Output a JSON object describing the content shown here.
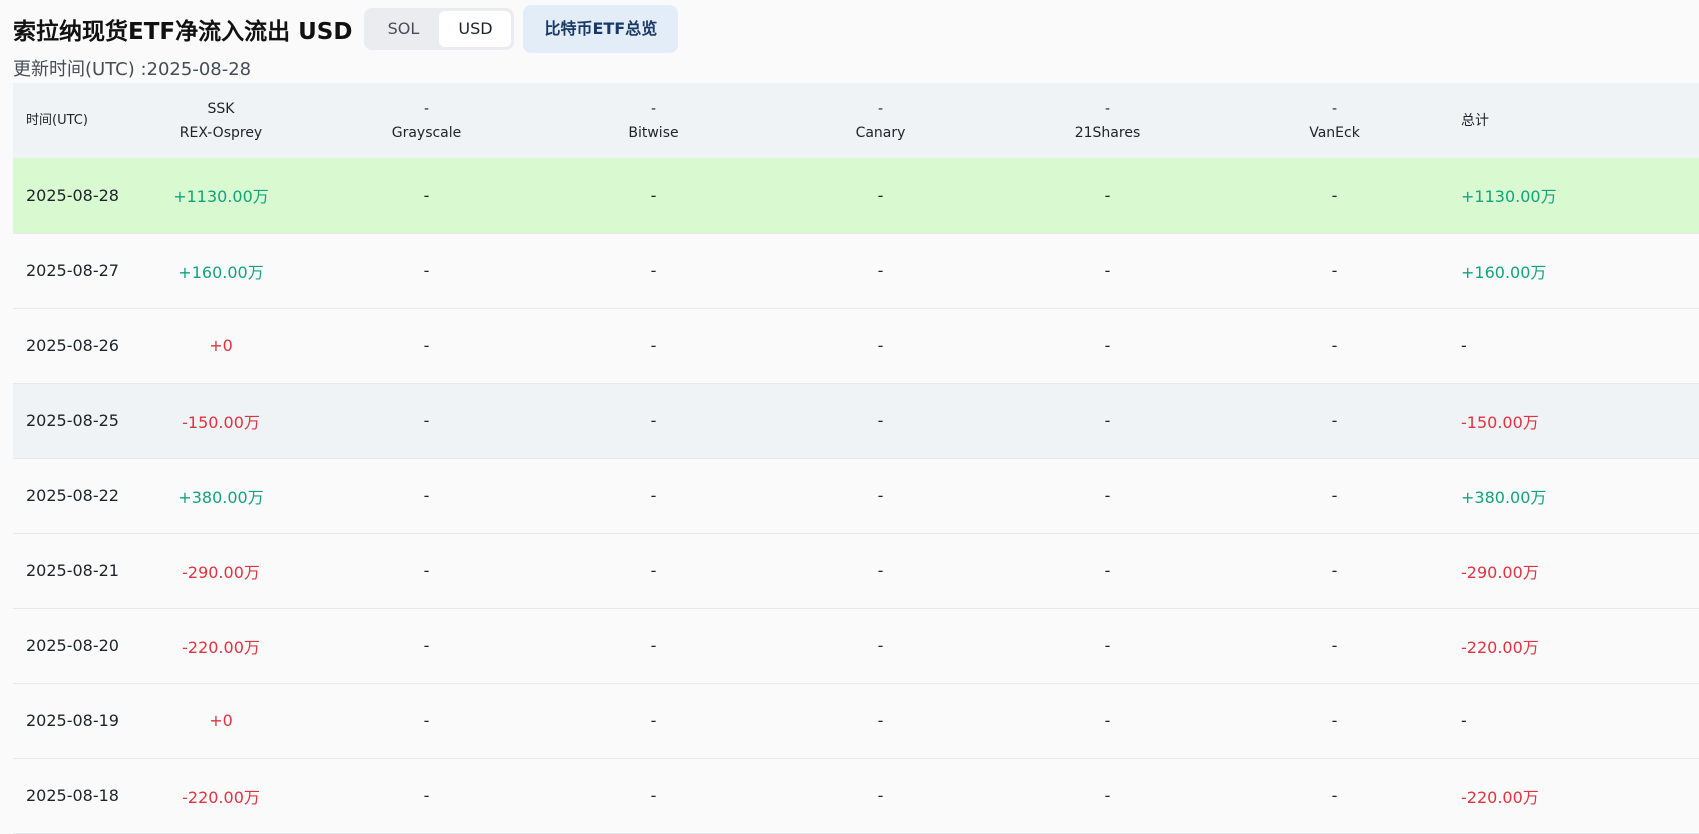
{
  "header": {
    "title": "索拉纳现货ETF净流入流出 USD",
    "toggle": {
      "options": [
        "SOL",
        "USD"
      ],
      "selected": "USD"
    },
    "overview_button": "比特币ETF总览",
    "update_time": "更新时间(UTC) :2025-08-28"
  },
  "table": {
    "columns": [
      {
        "line1": "",
        "line2": "时间(UTC)"
      },
      {
        "line1": "SSK",
        "line2": "REX-Osprey"
      },
      {
        "line1": "-",
        "line2": "Grayscale"
      },
      {
        "line1": "-",
        "line2": "Bitwise"
      },
      {
        "line1": "-",
        "line2": "Canary"
      },
      {
        "line1": "-",
        "line2": "21Shares"
      },
      {
        "line1": "-",
        "line2": "VanEck"
      },
      {
        "line1": "",
        "line2": "总计"
      }
    ],
    "rows": [
      {
        "date": "2025-08-28",
        "cells": [
          "+1130.00万",
          "-",
          "-",
          "-",
          "-",
          "-"
        ],
        "total": "+1130.00万",
        "sign": "pos",
        "total_sign": "pos",
        "style": "highlight"
      },
      {
        "date": "2025-08-27",
        "cells": [
          "+160.00万",
          "-",
          "-",
          "-",
          "-",
          "-"
        ],
        "total": "+160.00万",
        "sign": "pos",
        "total_sign": "pos",
        "style": "normal"
      },
      {
        "date": "2025-08-26",
        "cells": [
          "+0",
          "-",
          "-",
          "-",
          "-",
          "-"
        ],
        "total": "-",
        "sign": "neg",
        "total_sign": "none",
        "style": "normal"
      },
      {
        "date": "2025-08-25",
        "cells": [
          "-150.00万",
          "-",
          "-",
          "-",
          "-",
          "-"
        ],
        "total": "-150.00万",
        "sign": "neg",
        "total_sign": "neg",
        "style": "alt"
      },
      {
        "date": "2025-08-22",
        "cells": [
          "+380.00万",
          "-",
          "-",
          "-",
          "-",
          "-"
        ],
        "total": "+380.00万",
        "sign": "pos",
        "total_sign": "pos",
        "style": "normal"
      },
      {
        "date": "2025-08-21",
        "cells": [
          "-290.00万",
          "-",
          "-",
          "-",
          "-",
          "-"
        ],
        "total": "-290.00万",
        "sign": "neg",
        "total_sign": "neg",
        "style": "normal"
      },
      {
        "date": "2025-08-20",
        "cells": [
          "-220.00万",
          "-",
          "-",
          "-",
          "-",
          "-"
        ],
        "total": "-220.00万",
        "sign": "neg",
        "total_sign": "neg",
        "style": "normal"
      },
      {
        "date": "2025-08-19",
        "cells": [
          "+0",
          "-",
          "-",
          "-",
          "-",
          "-"
        ],
        "total": "-",
        "sign": "neg",
        "total_sign": "none",
        "style": "normal"
      },
      {
        "date": "2025-08-18",
        "cells": [
          "-220.00万",
          "-",
          "-",
          "-",
          "-",
          "-"
        ],
        "total": "-220.00万",
        "sign": "neg",
        "total_sign": "neg",
        "style": "normal"
      }
    ]
  },
  "colors": {
    "positive": "#11a37f",
    "negative": "#e0323f",
    "highlight_row": "#d9f9d0",
    "header_bg": "#eff3f6",
    "overview_button_bg": "#e3edf8"
  }
}
